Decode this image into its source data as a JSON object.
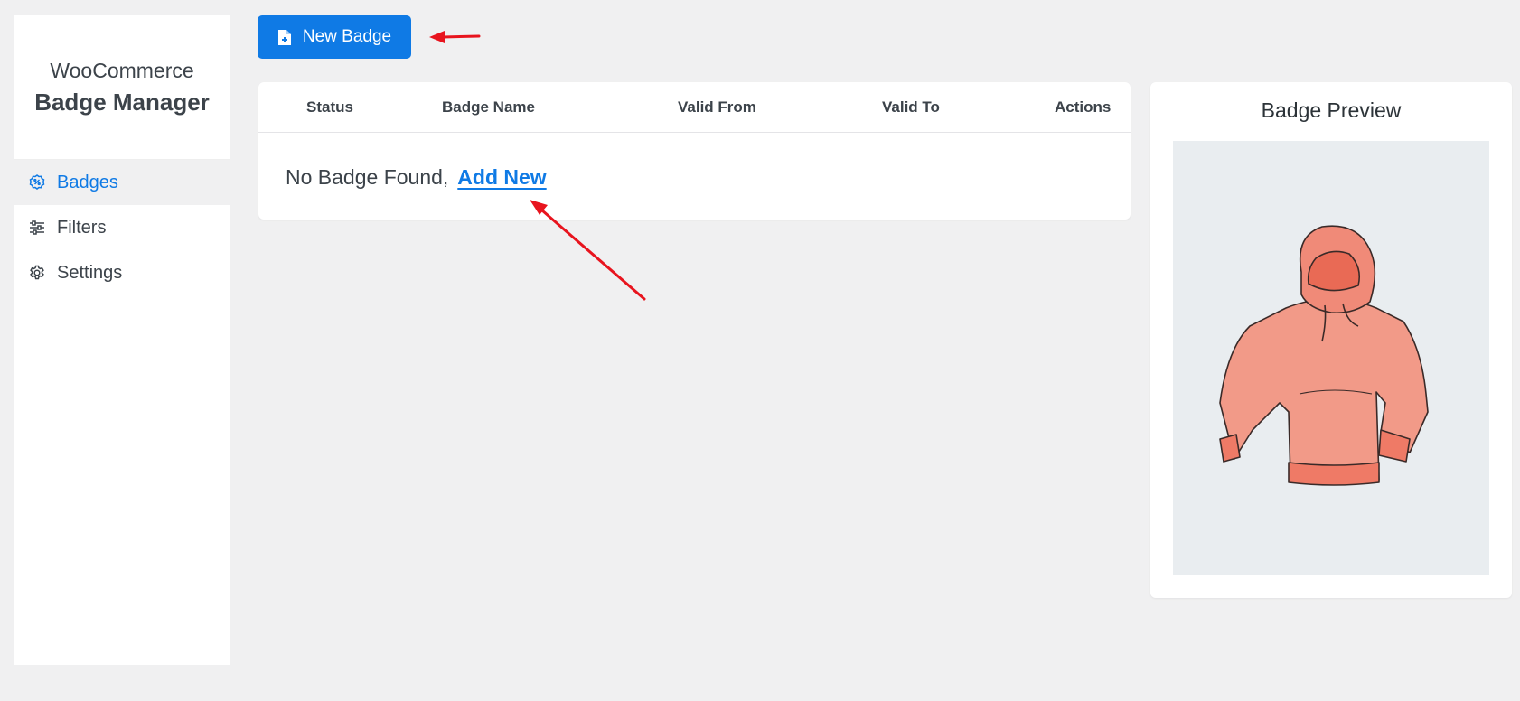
{
  "sidebar": {
    "brand_top": "WooCommerce",
    "brand_main": "Badge Manager",
    "items": [
      {
        "label": "Badges",
        "icon": "badge-percent-icon",
        "active": true
      },
      {
        "label": "Filters",
        "icon": "sliders-icon",
        "active": false
      },
      {
        "label": "Settings",
        "icon": "gear-icon",
        "active": false
      }
    ]
  },
  "toolbar": {
    "new_badge_label": "New Badge",
    "new_badge_icon": "file-plus-icon"
  },
  "table": {
    "columns": [
      "Status",
      "Badge Name",
      "Valid From",
      "Valid To",
      "Actions"
    ],
    "empty_text": "No Badge Found,",
    "add_new_label": "Add New"
  },
  "preview": {
    "title": "Badge Preview",
    "image": "hoodie-product-image"
  },
  "colors": {
    "accent": "#0f7ae5",
    "annotation": "#e8141e",
    "hoodie": "#f08a78"
  }
}
